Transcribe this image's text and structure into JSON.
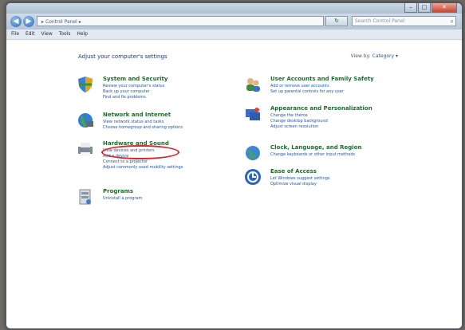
{
  "window": {
    "controls": {
      "minimize": "–",
      "maximize": "□",
      "close": "✕"
    },
    "address": {
      "root": "Control Panel"
    },
    "search_placeholder": "Search Control Panel",
    "refresh": "↻"
  },
  "menu": [
    "File",
    "Edit",
    "View",
    "Tools",
    "Help"
  ],
  "content": {
    "heading": "Adjust your computer's settings",
    "view_by_label": "View by:",
    "view_by_value": "Category ▾"
  },
  "categories": [
    {
      "title": "System and Security",
      "icon": "shield-icon",
      "links": [
        "Review your computer's status",
        "Back up your computer",
        "Find and fix problems"
      ]
    },
    {
      "title": "Network and Internet",
      "icon": "globe-icon",
      "links": [
        "View network status and tasks",
        "Choose homegroup and sharing options"
      ]
    },
    {
      "title": "Hardware and Sound",
      "icon": "printer-icon",
      "links": [
        "View devices and printers",
        "Add a device",
        "Connect to a projector",
        "Adjust commonly used mobility settings"
      ]
    },
    {
      "title": "Programs",
      "icon": "programs-icon",
      "links": [
        "Uninstall a program"
      ]
    },
    {
      "title": "User Accounts and Family Safety",
      "icon": "users-icon",
      "links": [
        "Add or remove user accounts",
        "Set up parental controls for any user"
      ]
    },
    {
      "title": "Appearance and Personalization",
      "icon": "palette-icon",
      "links": [
        "Change the theme",
        "Change desktop background",
        "Adjust screen resolution"
      ]
    },
    {
      "title": "Clock, Language, and Region",
      "icon": "clock-globe-icon",
      "links": [
        "Change keyboards or other input methods"
      ]
    },
    {
      "title": "Ease of Access",
      "icon": "ease-of-access-icon",
      "links": [
        "Let Windows suggest settings",
        "Optimize visual display"
      ]
    }
  ],
  "colors": {
    "title_green": "#1a6e2b",
    "link_blue": "#1f55a8",
    "highlight_red": "#d42a2a"
  }
}
